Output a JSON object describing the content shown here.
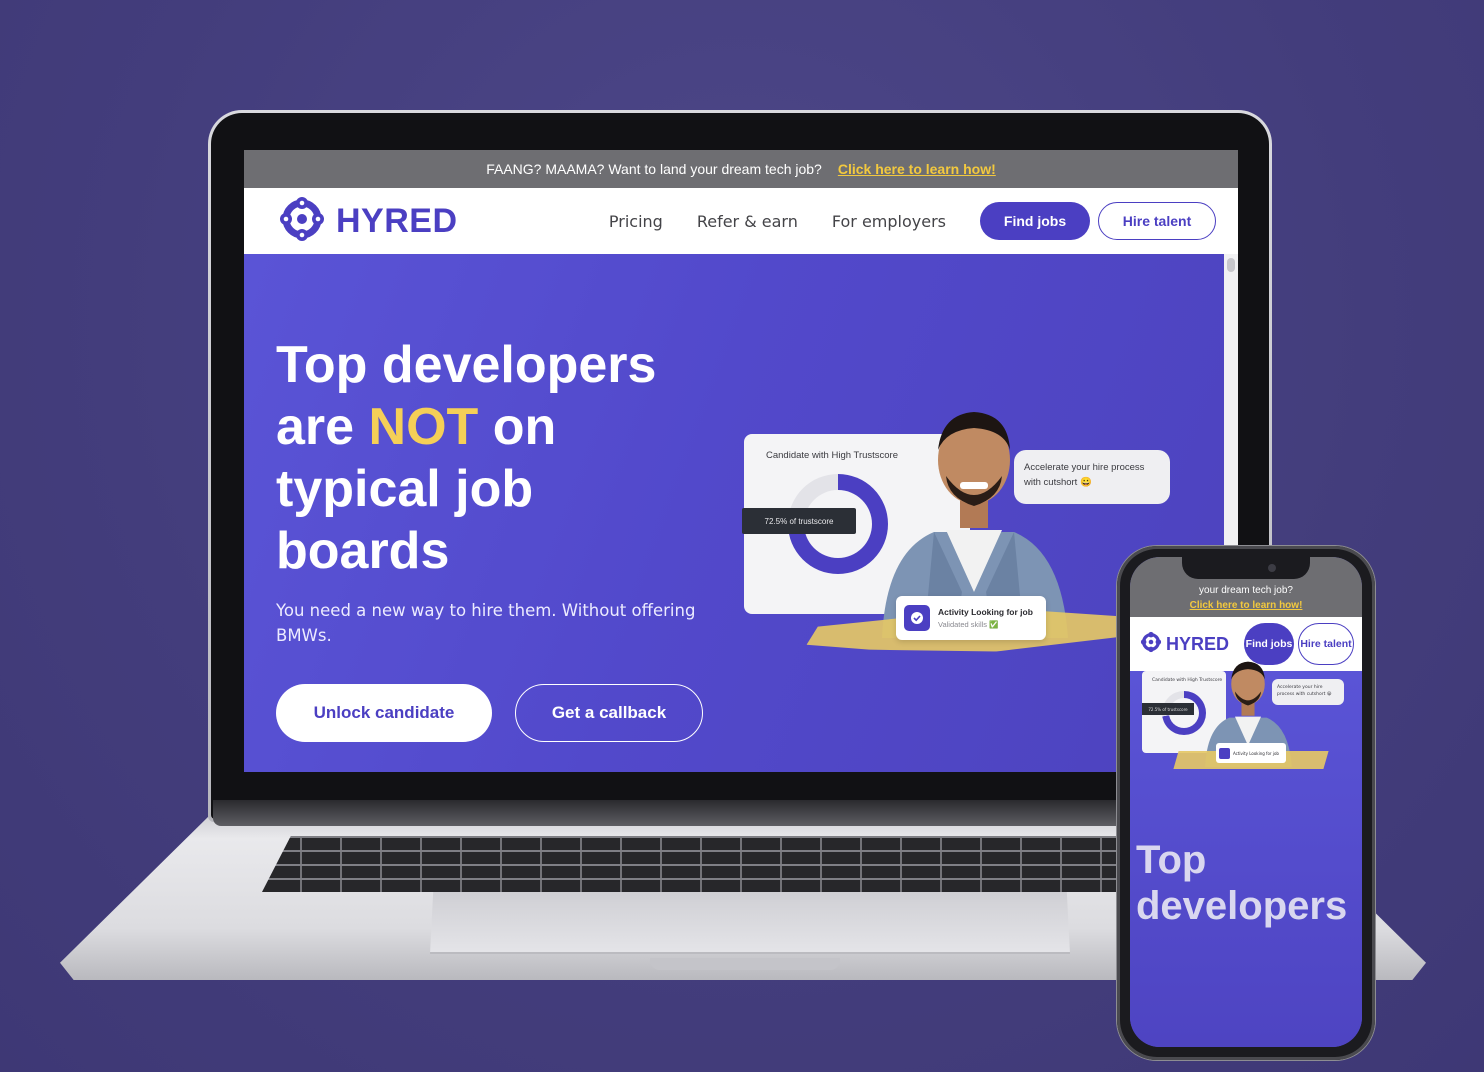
{
  "colors": {
    "background": "#45407f",
    "brand": "#4b3fc2",
    "highlight": "#f5cf57",
    "promo_link": "#f3c93e",
    "promo_bar": "#6e6e72"
  },
  "desktop": {
    "promo": {
      "text": "FAANG? MAAMA? Want to land your dream tech job?",
      "link": "Click here to learn how!"
    },
    "nav": {
      "logo": "HYRED",
      "logo_icon": "network-nodes-icon",
      "links": [
        "Pricing",
        "Refer & earn",
        "For employers"
      ],
      "find_jobs": "Find jobs",
      "hire_talent": "Hire talent"
    },
    "hero": {
      "title_line1": "Top developers",
      "title_line2_pre": "are ",
      "title_line2_highlight": "NOT",
      "title_line2_post": " on",
      "title_line3": "typical job",
      "title_line4": "boards",
      "subtitle": "You need a new way to hire them. Without offering BMWs.",
      "cta_primary": "Unlock candidate",
      "cta_secondary": "Get a callback"
    },
    "illustration": {
      "card_title": "Candidate with High Trustscore",
      "trustscore_fraction": 0.725,
      "trustscore_label": "72.5% of trustscore",
      "bubble": "Accelerate your hire process with cutshort 😀",
      "activity_title": "Activity Looking for job",
      "activity_sub": "Validated skills ✅"
    }
  },
  "mobile": {
    "promo": {
      "line1": "your dream tech job?",
      "link": "Click here to learn how!"
    },
    "nav": {
      "logo": "HYRED",
      "find_jobs": "Find jobs",
      "hire_talent": "Hire talent"
    },
    "hero_title_line1": "Top",
    "hero_title_line2": "developers"
  }
}
